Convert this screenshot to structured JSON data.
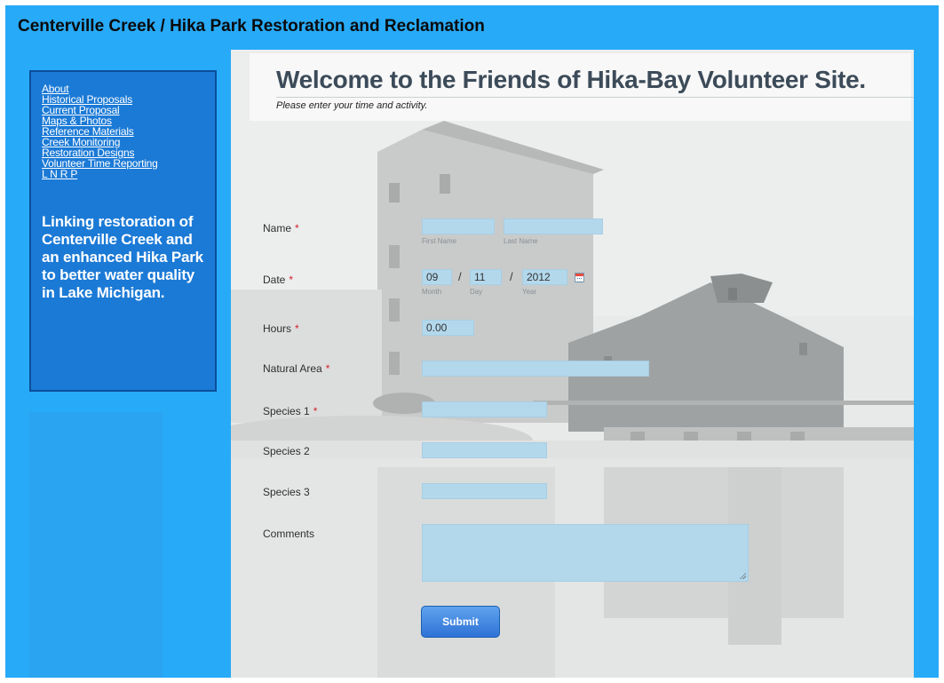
{
  "site_title": "Centerville Creek / Hika Park Restoration and Reclamation",
  "nav": {
    "items": [
      "About",
      "Historical Proposals",
      "Current Proposal",
      "Maps & Photos",
      "Reference Materials",
      "Creek Monitoring",
      "Restoration Designs",
      "Volunteer Time Reporting",
      "L N R P"
    ],
    "tagline": "Linking restoration of Centerville Creek and an enhanced Hika Park to better water quality in Lake Michigan."
  },
  "page": {
    "heading": "Welcome to the Friends of Hika-Bay Volunteer Site.",
    "subtitle": "Please enter your time and activity."
  },
  "form": {
    "required_marker": "*",
    "name": {
      "label": "Name",
      "first_sub": "First Name",
      "last_sub": "Last Name",
      "first_value": "",
      "last_value": ""
    },
    "date": {
      "label": "Date",
      "month": "09",
      "day": "11",
      "year": "2012",
      "month_sub": "Month",
      "day_sub": "Day",
      "year_sub": "Year",
      "separator": "/"
    },
    "hours": {
      "label": "Hours",
      "value": "0.00"
    },
    "natural_area": {
      "label": "Natural Area",
      "value": ""
    },
    "species1": {
      "label": "Species 1",
      "value": ""
    },
    "species2": {
      "label": "Species 2",
      "value": ""
    },
    "species3": {
      "label": "Species 3",
      "value": ""
    },
    "comments": {
      "label": "Comments",
      "value": ""
    },
    "submit_label": "Submit"
  },
  "colors": {
    "page_bg": "#27aaf8",
    "nav_bg": "#1b7ad6",
    "field_bg": "#b3d8ec",
    "required": "#d4202a",
    "button": "#2f72d6"
  },
  "icons": {
    "date_picker": "calendar-icon"
  }
}
